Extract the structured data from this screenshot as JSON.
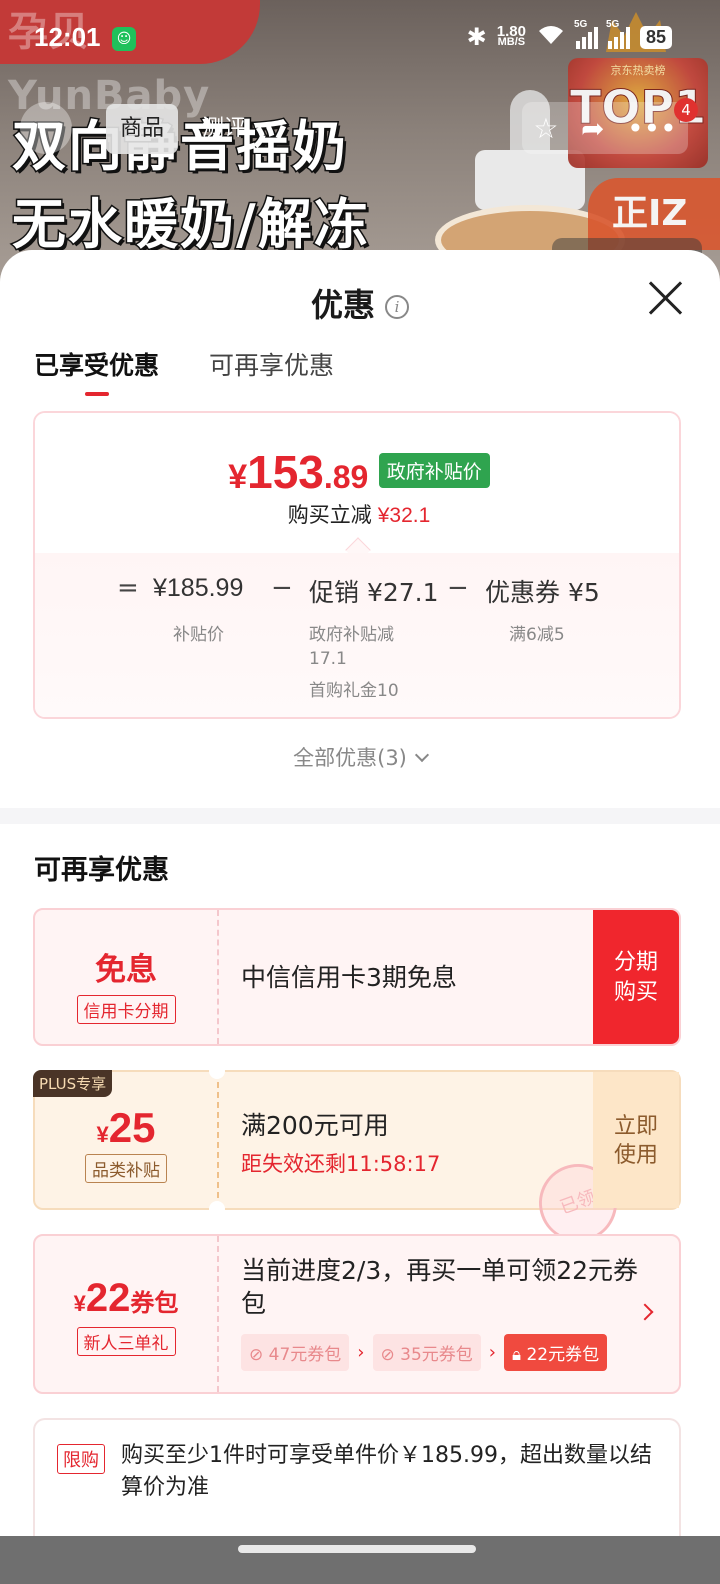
{
  "status_bar": {
    "time": "12:01",
    "speed_value": "1.80",
    "speed_unit": "MB/S",
    "net1": "5G",
    "net2": "5G",
    "battery": "85"
  },
  "background": {
    "brand": "孕贝 YunBaby",
    "headline_1": "双向静音摇奶",
    "headline_2": "无水暖奶/解冻",
    "badge_small": "京东热卖榜",
    "badge_big": "TOP1",
    "corner_tag": "正IZ"
  },
  "nav": {
    "tabs": [
      "商品",
      "测评"
    ],
    "badge_count": "4",
    "icons": [
      "back-icon",
      "star-icon",
      "share-icon",
      "more-icon"
    ]
  },
  "sheet": {
    "title": "优惠",
    "tabs": [
      "已享受优惠",
      "可再享优惠"
    ],
    "enjoyed": {
      "price_currency": "¥",
      "price_int": "153",
      "price_dec": ".89",
      "price_badge": "政府补贴价",
      "reduce_label": "购买立减",
      "reduce_amount": "¥32.1",
      "calc": {
        "eq": "=",
        "base_value": "¥185.99",
        "base_label": "补贴价",
        "minus": "−",
        "promo_value": "促销 ¥27.1",
        "promo_sub_1": "政府补贴减",
        "promo_sub_2": "17.1",
        "promo_sub_3": "首购礼金10",
        "coupon_value": "优惠券 ¥5",
        "coupon_sub": "满6减5"
      }
    },
    "all_offers": "全部优惠(3)",
    "section2_title": "可再享优惠",
    "coupons": {
      "c1": {
        "big": "免息",
        "tag": "信用卡分期",
        "desc": "中信信用卡3期免息",
        "btn_1": "分期",
        "btn_2": "购买"
      },
      "c2": {
        "plus": "PLUS专享",
        "cur": "¥",
        "amount": "25",
        "tag": "品类补贴",
        "cond": "满200元可用",
        "expire": "距失效还剩11:58:17",
        "btn_1": "立即",
        "btn_2": "使用",
        "stamp": "已领"
      },
      "c3": {
        "cur": "¥",
        "amount": "22",
        "unit": "券包",
        "tag": "新人三单礼",
        "desc": "当前进度2/3，再买一单可领22元券包",
        "steps": [
          "47元券包",
          "35元券包",
          "22元券包"
        ]
      }
    },
    "limit": {
      "tag": "限购",
      "text": "购买至少1件时可享受单件价￥185.99，超出数量以结算价为准"
    }
  }
}
